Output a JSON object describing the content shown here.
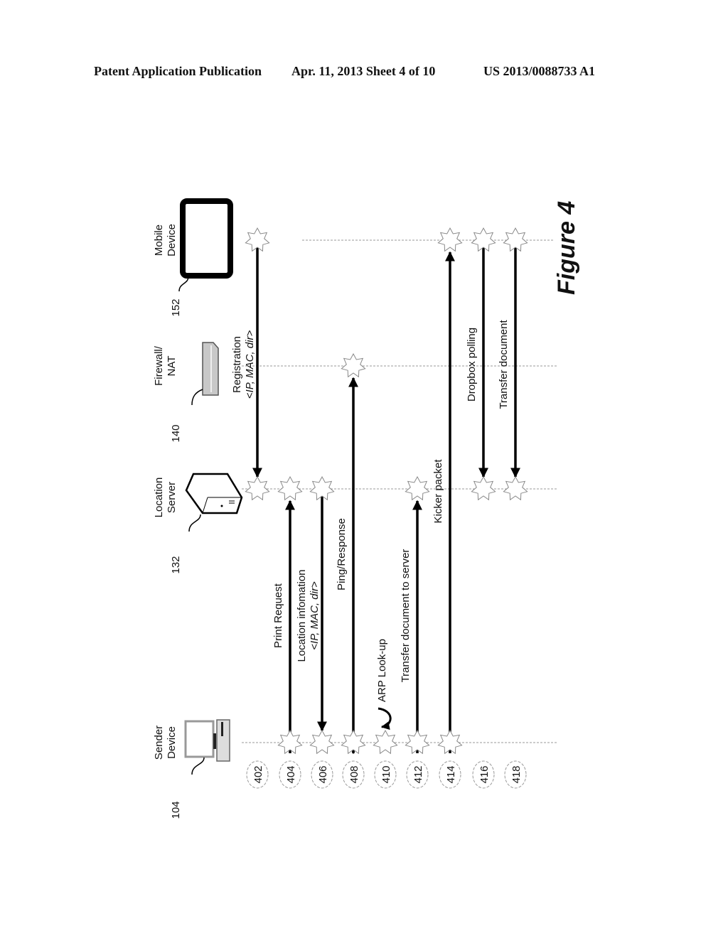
{
  "header": {
    "publication": "Patent Application Publication",
    "date_sheet": "Apr. 11, 2013  Sheet 4 of 10",
    "patent_number": "US 2013/0088733 A1"
  },
  "figure_label": "Figure 4",
  "participants": [
    {
      "id": "sender",
      "name_line1": "Sender",
      "name_line2": "Device",
      "ref": "104",
      "icon": "computer-icon"
    },
    {
      "id": "location",
      "name_line1": "Location",
      "name_line2": "Server",
      "ref": "132",
      "icon": "server-icon"
    },
    {
      "id": "firewall",
      "name_line1": "Firewall/",
      "name_line2": "NAT",
      "ref": "140",
      "icon": "router-icon"
    },
    {
      "id": "mobile",
      "name_line1": "Mobile",
      "name_line2": "Device",
      "ref": "152",
      "icon": "tablet-icon"
    }
  ],
  "steps": [
    {
      "ref": "402",
      "from": "mobile",
      "to": "location",
      "label": "Registration",
      "sublabel": "<IP, MAC, dir>",
      "arrow": "forward"
    },
    {
      "ref": "404",
      "from": "sender",
      "to": "location",
      "label": "Print Request",
      "sublabel": "",
      "arrow": "forward"
    },
    {
      "ref": "406",
      "from": "location",
      "to": "sender",
      "label": "Location infomation",
      "sublabel": "<IP, MAC, dir>",
      "arrow": "forward"
    },
    {
      "ref": "408",
      "from": "sender",
      "to": "firewall",
      "label": "Ping/Response",
      "sublabel": "",
      "arrow": "both"
    },
    {
      "ref": "410",
      "from": "sender",
      "to": "sender",
      "label": "ARP Look-up",
      "sublabel": "",
      "arrow": "self"
    },
    {
      "ref": "412",
      "from": "sender",
      "to": "location",
      "label": "Transfer document to server",
      "sublabel": "",
      "arrow": "forward"
    },
    {
      "ref": "414",
      "from": "sender",
      "to": "mobile",
      "label": "Kicker packet",
      "sublabel": "",
      "arrow": "forward"
    },
    {
      "ref": "416",
      "from": "mobile",
      "to": "location",
      "label": "Dropbox polling",
      "sublabel": "",
      "arrow": "forward"
    },
    {
      "ref": "418",
      "from": "mobile",
      "to": "location",
      "label": "Transfer document",
      "sublabel": "",
      "arrow": "both"
    }
  ]
}
